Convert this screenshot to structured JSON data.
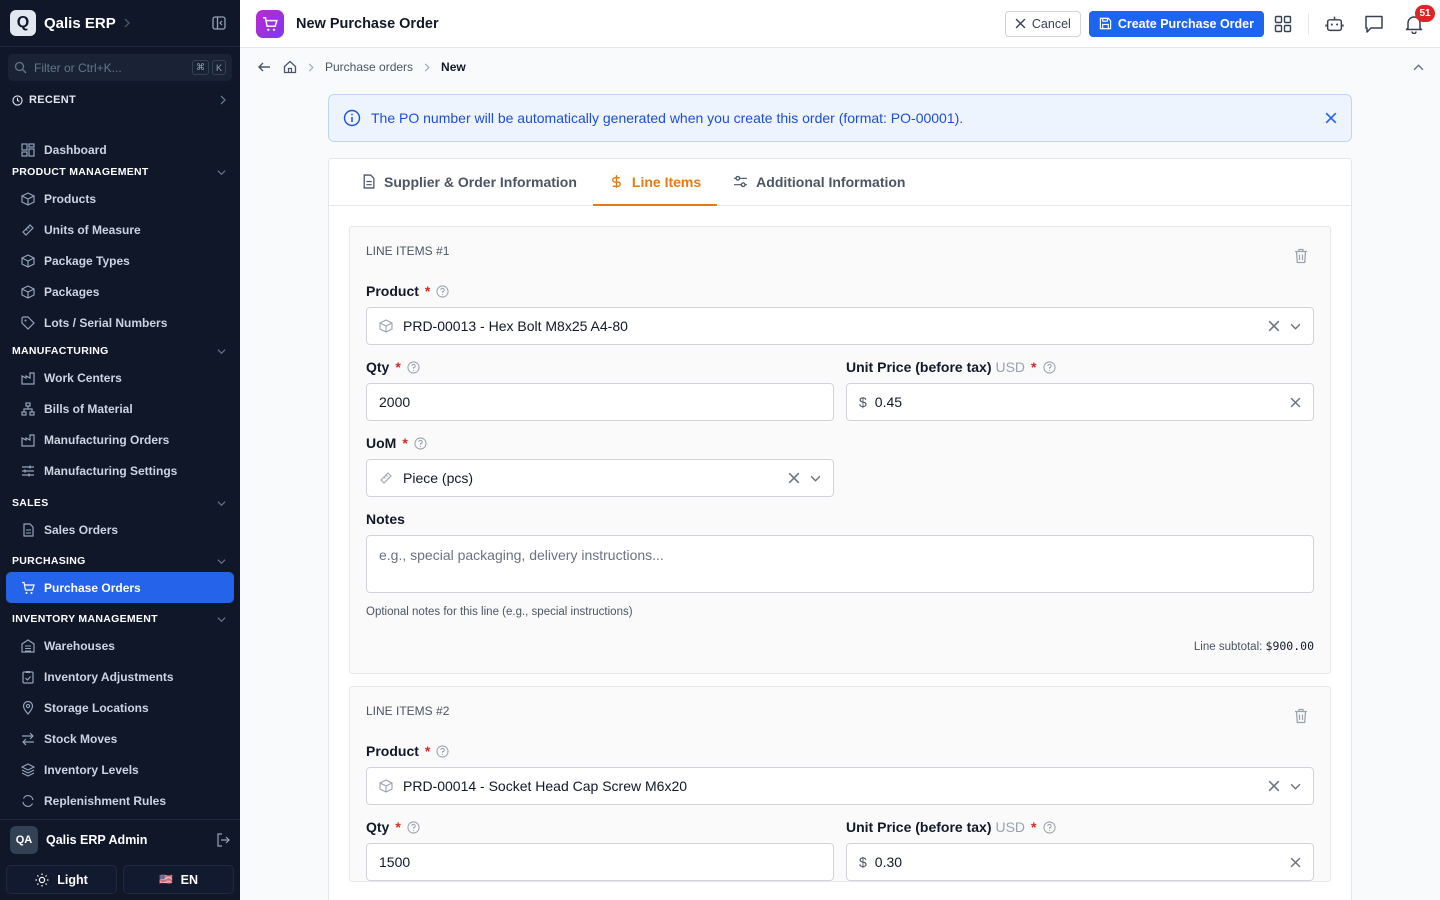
{
  "app": {
    "logo_letter": "Q",
    "name": "Qalis ERP"
  },
  "sidebar": {
    "search_placeholder": "Filter or Ctrl+K...",
    "kbd1": "⌘",
    "kbd2": "K",
    "recent_label": "RECENT",
    "dashboard": "Dashboard",
    "groups": {
      "product": "PRODUCT MANAGEMENT",
      "manufacturing": "MANUFACTURING",
      "sales": "SALES",
      "purchasing": "PURCHASING",
      "inventory": "INVENTORY MANAGEMENT"
    },
    "items": {
      "products": "Products",
      "uom": "Units of Measure",
      "package_types": "Package Types",
      "packages": "Packages",
      "lots": "Lots / Serial Numbers",
      "work_centers": "Work Centers",
      "bom": "Bills of Material",
      "mo": "Manufacturing Orders",
      "mfg_settings": "Manufacturing Settings",
      "sales_orders": "Sales Orders",
      "purchase_orders": "Purchase Orders",
      "warehouses": "Warehouses",
      "inv_adjust": "Inventory Adjustments",
      "storage": "Storage Locations",
      "stock_moves": "Stock Moves",
      "inv_levels": "Inventory Levels",
      "replenish": "Replenishment Rules"
    },
    "user": {
      "initials": "QA",
      "name": "Qalis ERP Admin"
    },
    "theme_label": "Light",
    "lang_flag": "🇺🇸",
    "lang_label": "EN"
  },
  "header": {
    "title": "New Purchase Order",
    "cancel_label": "Cancel",
    "create_label": "Create Purchase Order",
    "notif_count": "51"
  },
  "breadcrumb": {
    "parent": "Purchase orders",
    "current": "New"
  },
  "banner": {
    "text": "The PO number will be automatically generated when you create this order (format: PO-00001)."
  },
  "tabs": [
    {
      "label": "Supplier & Order Information"
    },
    {
      "label": "Line Items"
    },
    {
      "label": "Additional Information"
    }
  ],
  "labels": {
    "product": "Product",
    "qty": "Qty",
    "unit_price": "Unit Price (before tax)",
    "currency": "USD",
    "uom": "UoM",
    "notes": "Notes",
    "required": "*",
    "dollar": "$",
    "notes_placeholder": "e.g., special packaging, delivery instructions...",
    "notes_hint": "Optional notes for this line (e.g., special instructions)",
    "subtotal_label": "Line subtotal:"
  },
  "lines": [
    {
      "title": "LINE ITEMS #1",
      "product": "PRD-00013 - Hex Bolt M8x25 A4-80",
      "qty": "2000",
      "unit_price": "0.45",
      "uom": "Piece (pcs)",
      "subtotal": "$900.00"
    },
    {
      "title": "LINE ITEMS #2",
      "product": "PRD-00014 - Socket Head Cap Screw M6x20",
      "qty": "1500",
      "unit_price": "0.30"
    }
  ],
  "colors": {
    "sidebar_bg": "#0f1729",
    "primary": "#1d64f0",
    "active_tab": "#ea7a10",
    "badge": "#dc2626"
  }
}
